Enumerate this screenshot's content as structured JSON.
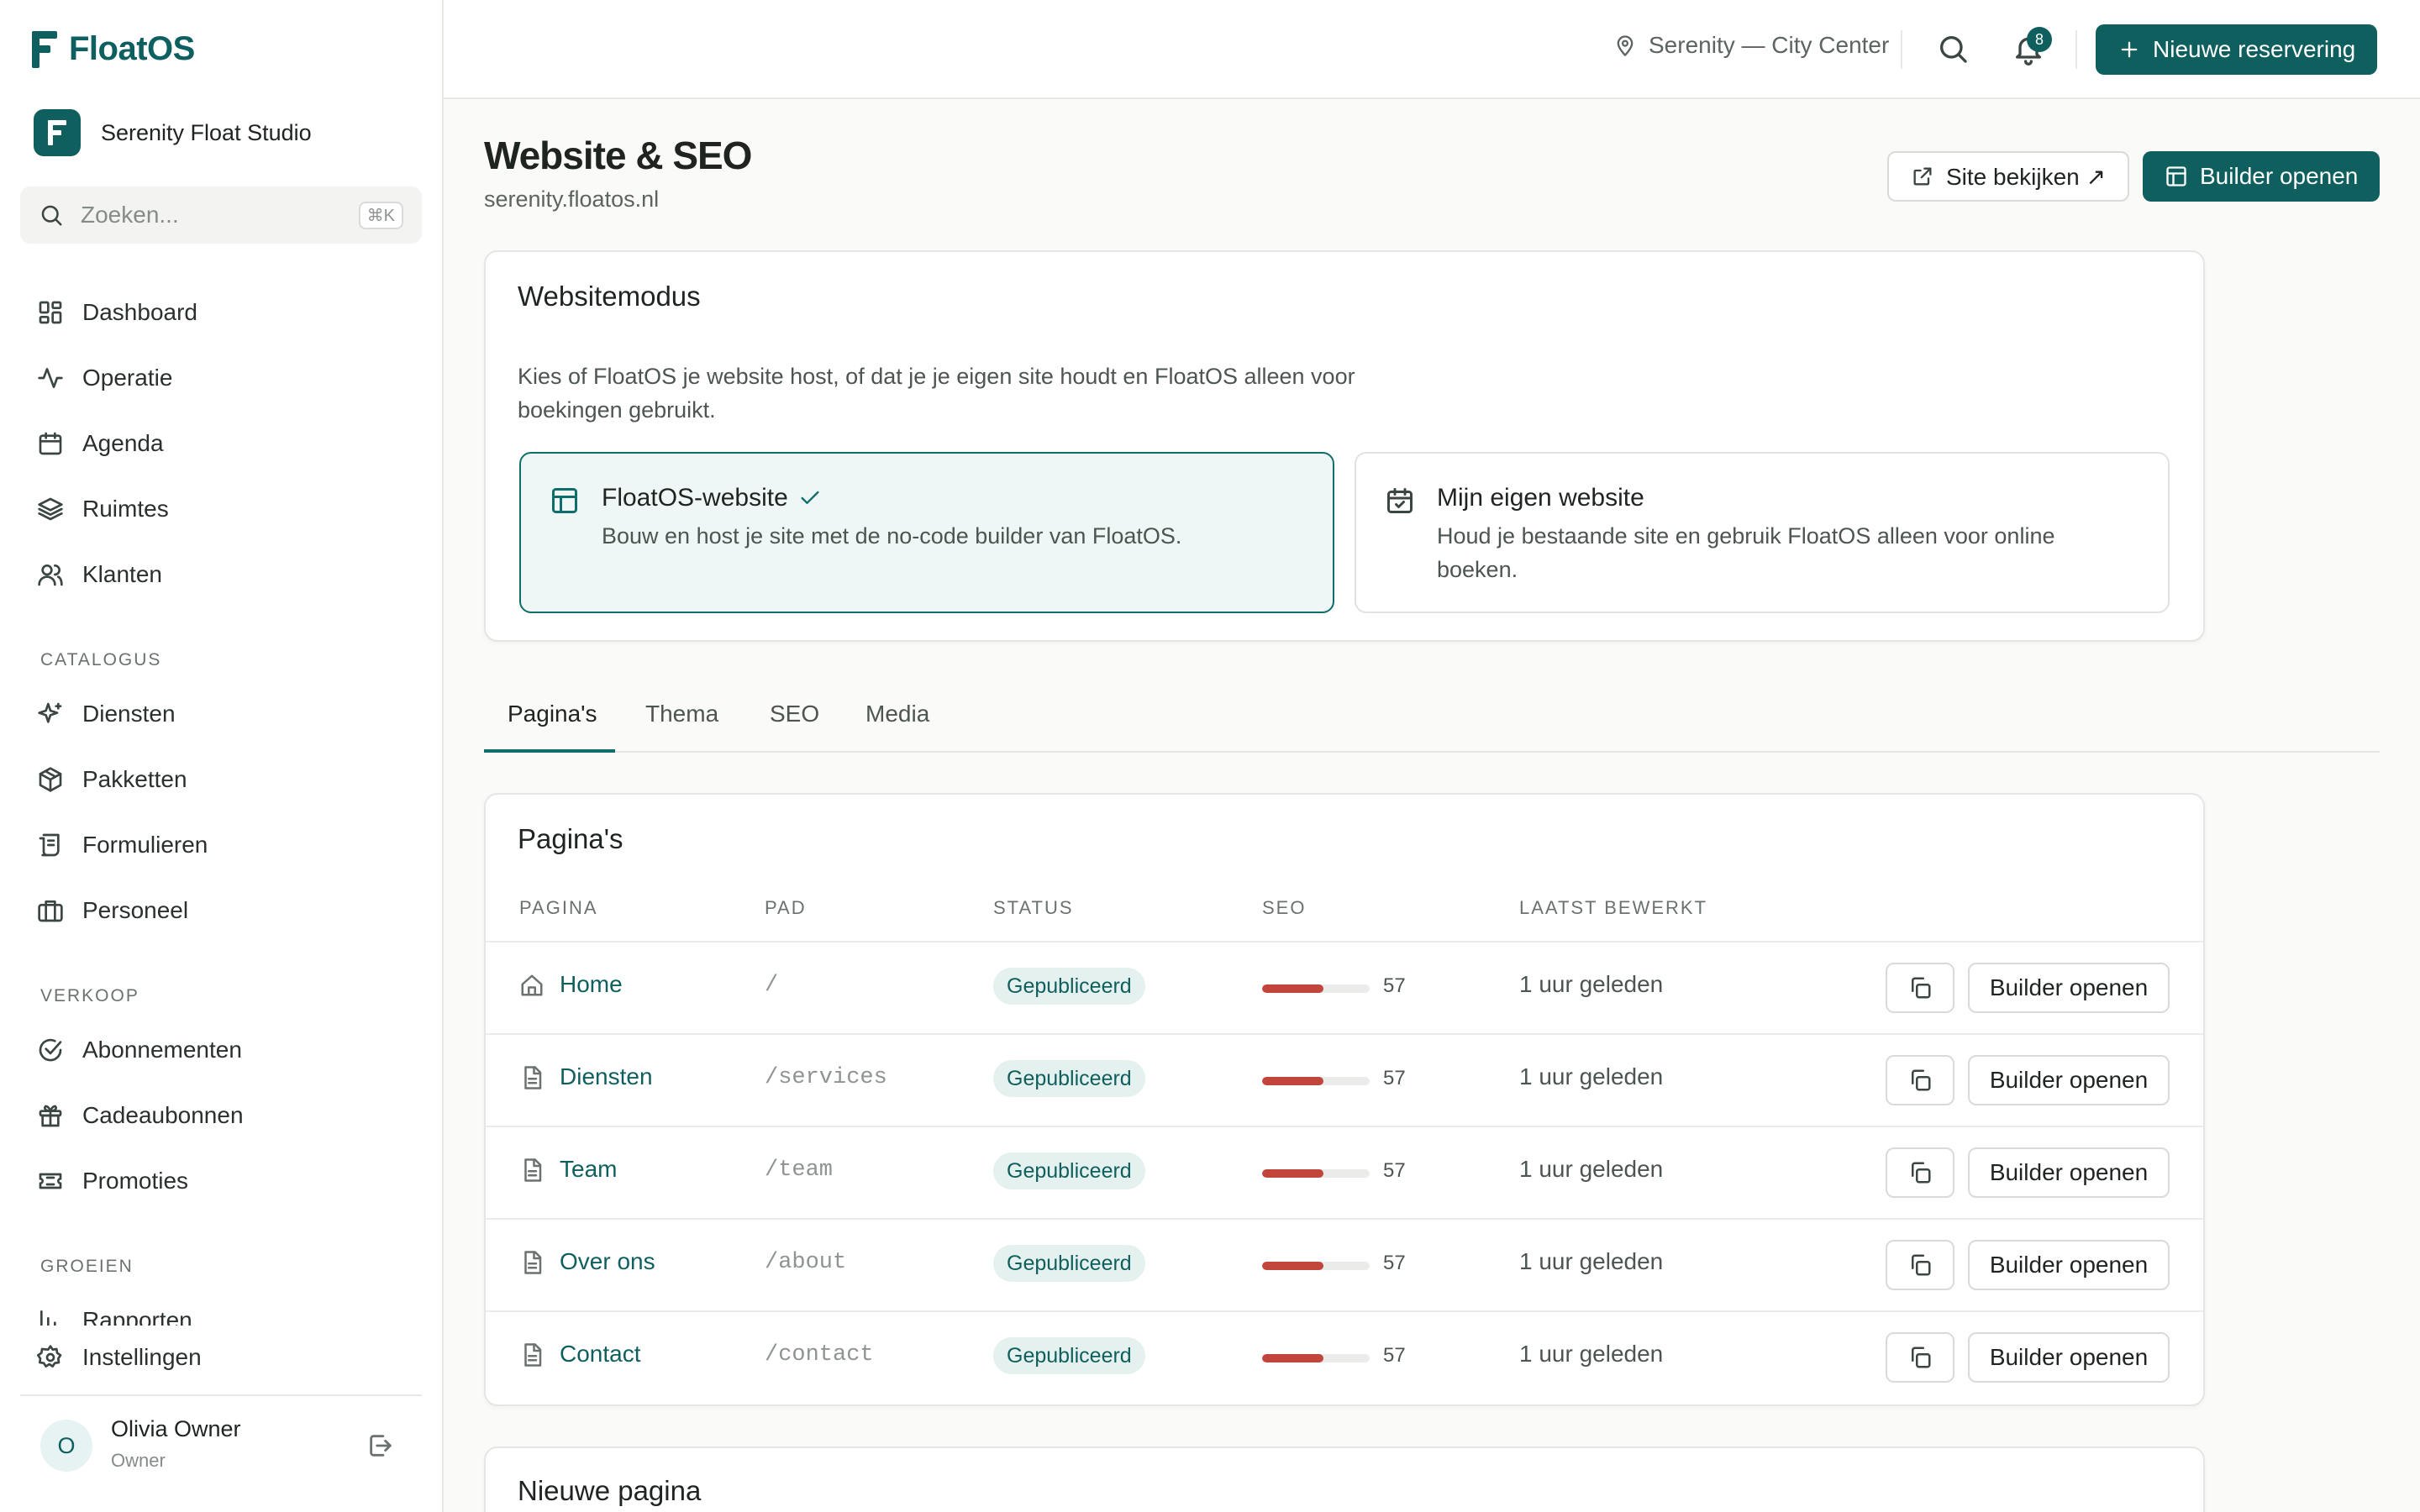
{
  "app": {
    "name": "FloatOS",
    "studio": "Serenity Float Studio",
    "brand_color": "#0f5f5e"
  },
  "search": {
    "placeholder": "Zoeken...",
    "shortcut": "⌘K"
  },
  "nav": {
    "main": [
      {
        "label": "Dashboard",
        "icon": "dashboard-icon"
      },
      {
        "label": "Operatie",
        "icon": "activity-icon"
      },
      {
        "label": "Agenda",
        "icon": "calendar-icon"
      },
      {
        "label": "Ruimtes",
        "icon": "layers-icon"
      },
      {
        "label": "Klanten",
        "icon": "users-icon"
      }
    ],
    "catalogus_title": "CATALOGUS",
    "catalogus": [
      {
        "label": "Diensten",
        "icon": "sparkles-icon"
      },
      {
        "label": "Pakketten",
        "icon": "package-icon"
      },
      {
        "label": "Formulieren",
        "icon": "form-icon"
      },
      {
        "label": "Personeel",
        "icon": "briefcase-icon"
      }
    ],
    "verkoop_title": "VERKOOP",
    "verkoop": [
      {
        "label": "Abonnementen",
        "icon": "check-circle-icon"
      },
      {
        "label": "Cadeaubonnen",
        "icon": "gift-icon"
      },
      {
        "label": "Promoties",
        "icon": "ticket-icon"
      }
    ],
    "groeien_title": "GROEIEN",
    "groeien": [
      {
        "label": "Rapporten",
        "icon": "bar-chart-icon"
      }
    ],
    "settings": "Instellingen"
  },
  "user": {
    "initial": "O",
    "name": "Olivia Owner",
    "role": "Owner"
  },
  "topbar": {
    "location": "Serenity — City Center",
    "notifications": "8",
    "new_button": "Nieuwe reservering"
  },
  "page": {
    "title": "Website & SEO",
    "domain": "serenity.floatos.nl",
    "view_site": "Site bekijken ↗",
    "open_builder": "Builder openen"
  },
  "mode_card": {
    "title": "Websitemodus",
    "description": "Kies of FloatOS je website host, of dat je je eigen site houdt en FloatOS alleen voor boekingen gebruikt.",
    "options": [
      {
        "title": "FloatOS-website",
        "desc": "Bouw en host je site met de no-code builder van FloatOS.",
        "selected": true
      },
      {
        "title": "Mijn eigen website",
        "desc": "Houd je bestaande site en gebruik FloatOS alleen voor online boeken.",
        "selected": false
      }
    ]
  },
  "tabs": [
    "Pagina's",
    "Thema",
    "SEO",
    "Media"
  ],
  "pages_card": {
    "title": "Pagina's",
    "columns": [
      "PAGINA",
      "PAD",
      "STATUS",
      "SEO",
      "LAATST BEWERKT"
    ],
    "rows": [
      {
        "name": "Home",
        "icon": "home-icon",
        "path": "/",
        "status": "Gepubliceerd",
        "seo": 57,
        "seo_label": "57",
        "edited": "1 uur geleden",
        "action": "Builder openen"
      },
      {
        "name": "Diensten",
        "icon": "file-icon",
        "path": "/services",
        "status": "Gepubliceerd",
        "seo": 57,
        "seo_label": "57",
        "edited": "1 uur geleden",
        "action": "Builder openen"
      },
      {
        "name": "Team",
        "icon": "file-icon",
        "path": "/team",
        "status": "Gepubliceerd",
        "seo": 57,
        "seo_label": "57",
        "edited": "1 uur geleden",
        "action": "Builder openen"
      },
      {
        "name": "Over ons",
        "icon": "file-icon",
        "path": "/about",
        "status": "Gepubliceerd",
        "seo": 57,
        "seo_label": "57",
        "edited": "1 uur geleden",
        "action": "Builder openen"
      },
      {
        "name": "Contact",
        "icon": "file-icon",
        "path": "/contact",
        "status": "Gepubliceerd",
        "seo": 57,
        "seo_label": "57",
        "edited": "1 uur geleden",
        "action": "Builder openen"
      }
    ]
  },
  "new_page_card": {
    "title": "Nieuwe pagina"
  }
}
